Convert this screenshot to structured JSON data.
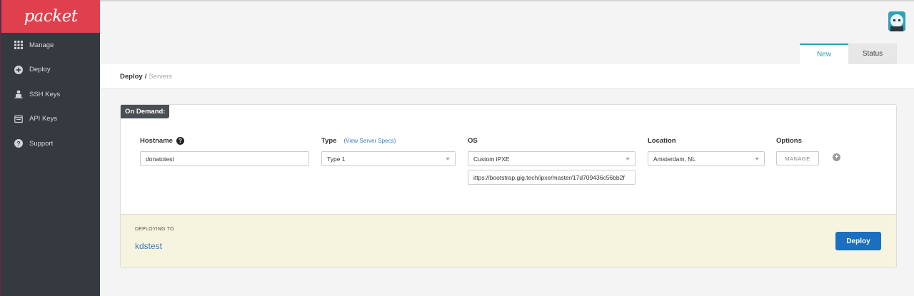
{
  "brand": {
    "logo": "packet",
    "accent": "#e0404e"
  },
  "sidebar": {
    "items": [
      {
        "label": "Manage",
        "icon": "grid-icon"
      },
      {
        "label": "Deploy",
        "icon": "plus-circle-icon"
      },
      {
        "label": "SSH Keys",
        "icon": "ssh-key-icon"
      },
      {
        "label": "API Keys",
        "icon": "api-key-icon"
      },
      {
        "label": "Support",
        "icon": "question-circle-icon"
      }
    ]
  },
  "tabs": {
    "new": "New",
    "status": "Status"
  },
  "breadcrumb": {
    "first": "Deploy",
    "separator": "/",
    "second": "Servers"
  },
  "form": {
    "badge": "On Demand:",
    "hostname": {
      "label": "Hostname",
      "help": "?",
      "value": "donatotest"
    },
    "type": {
      "label": "Type",
      "link": "(View Server Specs)",
      "value": "Type 1"
    },
    "os": {
      "label": "OS",
      "value": "Custom iPXE",
      "ipxe_url": "ittps://bootstrap.gig.tech/ipxe/master/17d709436c56bb2f"
    },
    "location": {
      "label": "Location",
      "value": "Amsterdam, NL"
    },
    "options": {
      "label": "Options",
      "manage": "MANAGE",
      "add": "+"
    }
  },
  "deploy": {
    "label": "DEPLOYING TO",
    "project": "kdstest",
    "button": "Deploy"
  }
}
